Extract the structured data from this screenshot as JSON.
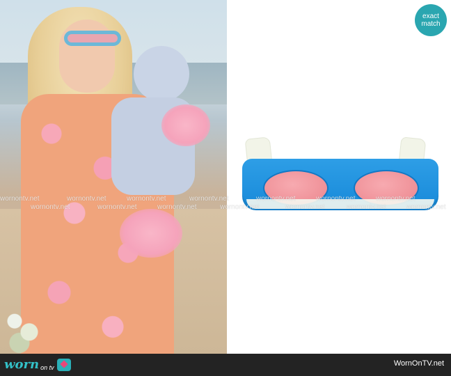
{
  "badge": {
    "line1": "exact",
    "line2": "match"
  },
  "watermark": {
    "text": "wornontv.net"
  },
  "footer": {
    "logo_word": "worn",
    "logo_sub": "on tv",
    "site": "WornOnTV.net"
  },
  "photo": {
    "description_icon": "person-photo"
  },
  "product": {
    "icon": "sunglasses-icon"
  },
  "colors": {
    "frame": "#1789d9",
    "lens": "#ef9198",
    "temple": "#f2f4e8",
    "badge": "#2aa6b0",
    "footer": "#232323"
  }
}
